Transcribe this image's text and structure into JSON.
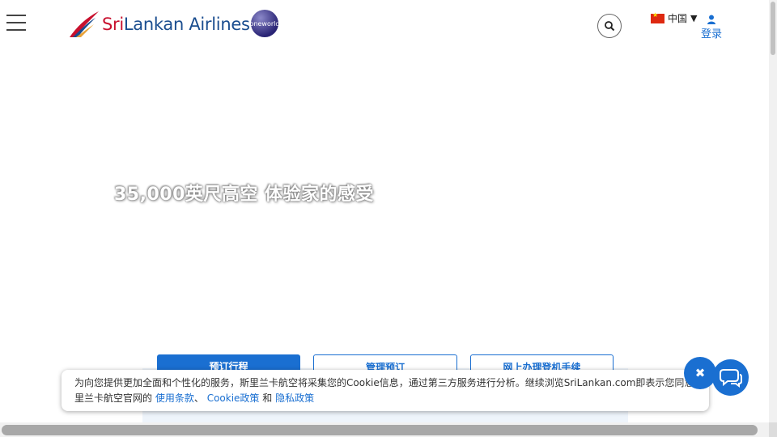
{
  "header": {
    "logo_text_red": "Sri",
    "logo_text_blue": "Lankan Airlines",
    "oneworld_badge": "oneworld",
    "language": "中国",
    "login_label": "登录"
  },
  "hero": {
    "tagline": "35,000英尺高空 体验家的感受"
  },
  "booking_tabs": [
    {
      "label": "预订行程"
    },
    {
      "label": "管理预订"
    },
    {
      "label": "网上办理登机手续"
    }
  ],
  "cookie_banner": {
    "text_line1": "为向您提供更加全面和个性化的服务，斯里兰卡航空将采集您的Cookie信息，通过第三方服务进行分析。继续浏览SriLankan.com即表示您同意斯",
    "text_line2_prefix": "里兰卡航空官网的",
    "link_terms": "使用条款",
    "sep1": "、",
    "link_cookie": "Cookie政策",
    "sep2": "和",
    "link_privacy": "隐私政策"
  },
  "icons": {
    "menu": "hamburger-menu-icon",
    "search": "search-icon",
    "flag": "china-flag-icon",
    "user": "user-icon",
    "close": "close-icon",
    "chat": "chat-icon"
  },
  "colors": {
    "brand_blue": "#1a6fd1",
    "logo_blue": "#1a4d8f",
    "logo_red": "#c8102e"
  }
}
